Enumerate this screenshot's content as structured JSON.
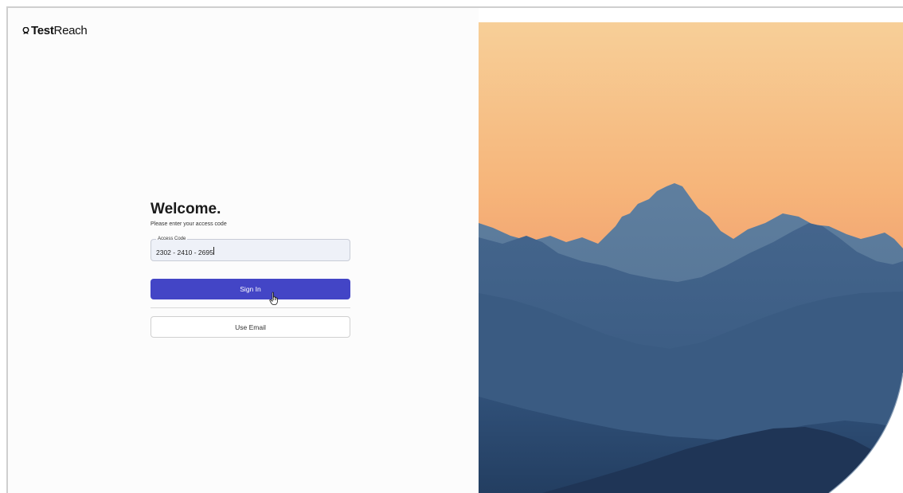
{
  "brand": {
    "name_bold": "Test",
    "name_regular": "Reach",
    "logo_icon": "badge-icon"
  },
  "login": {
    "title": "Welcome.",
    "subtitle": "Please enter your access code",
    "access_code_label": "Access Code",
    "access_code_value": "2302 - 2410 - 2695",
    "sign_in_label": "Sign In",
    "use_email_label": "Use Email"
  },
  "colors": {
    "primary_button": "#4345c6",
    "sky_top": "#f6c890",
    "sky_mid": "#f4a36e",
    "sky_low": "#e98a6a",
    "mountain_far": "#587999",
    "mountain_mid": "#3f6086",
    "mountain_near": "#2d4a6e"
  },
  "cursor": {
    "icon": "hand-pointer-icon"
  }
}
